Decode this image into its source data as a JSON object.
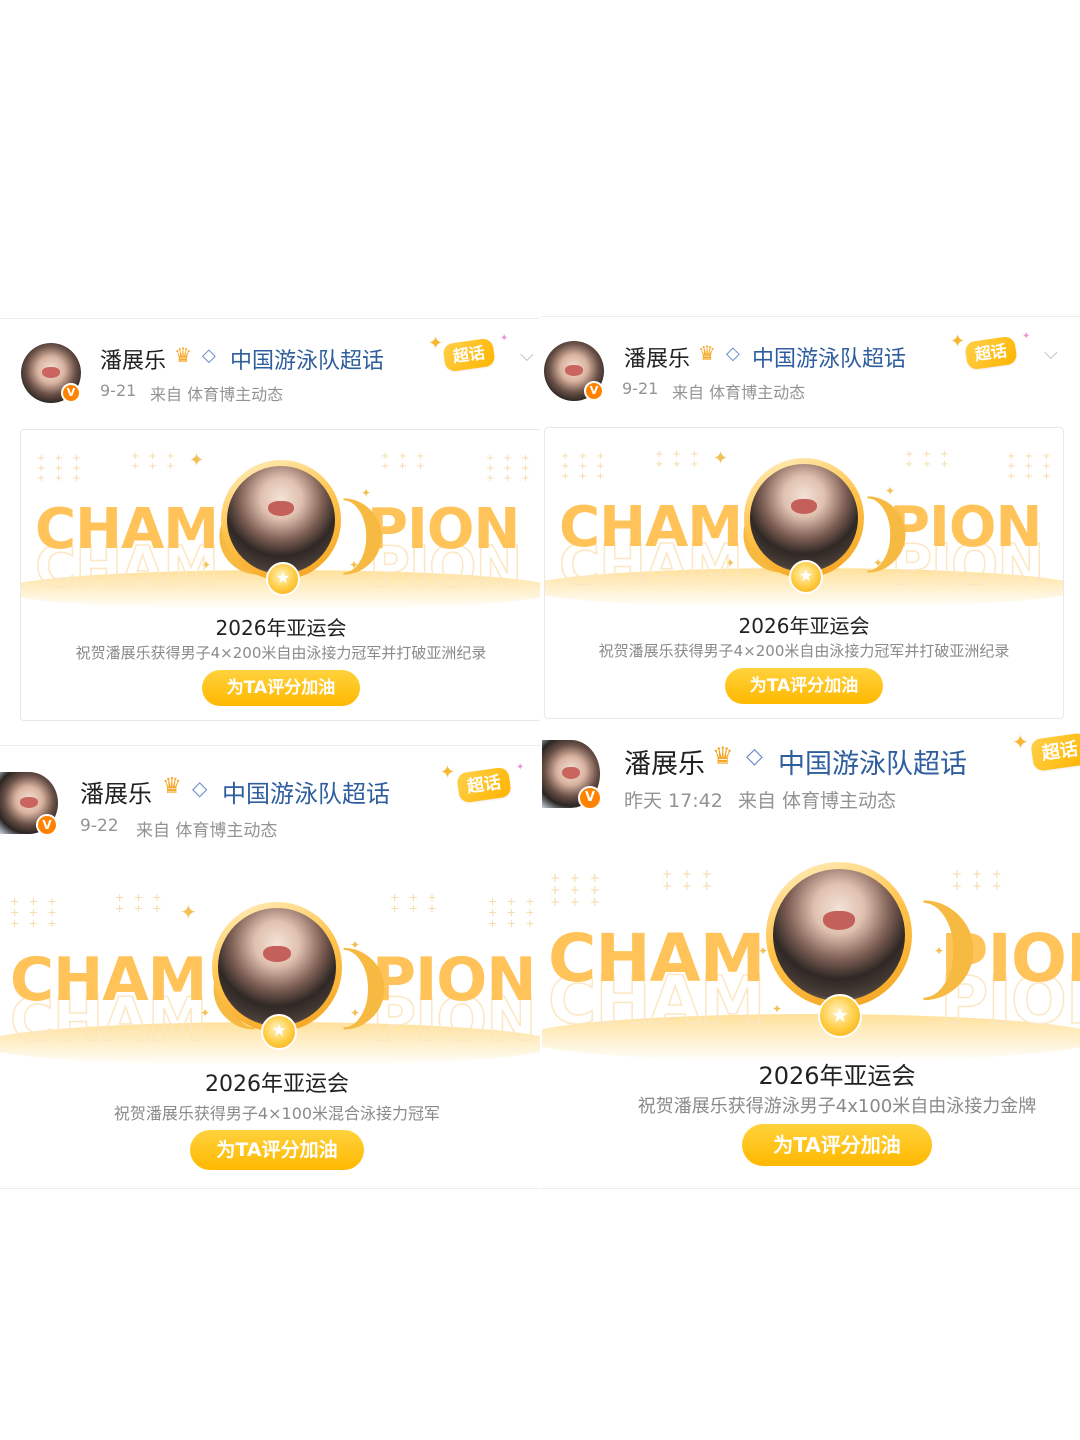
{
  "posts": [
    {
      "user": "潘展乐",
      "topic": "中国游泳队超话",
      "time": "9-21",
      "source": "来自 体育博主动态",
      "badge_label": "超话",
      "verified_mark": "V",
      "banner": {
        "left": "CHAM",
        "right": "PION"
      },
      "games": "2026年亚运会",
      "desc": "祝贺潘展乐获得男子4×200米自由泳接力冠军并打破亚洲纪录",
      "cta": "为TA评分加油"
    },
    {
      "user": "潘展乐",
      "topic": "中国游泳队超话",
      "time": "9-21",
      "source": "来自 体育博主动态",
      "badge_label": "超话",
      "verified_mark": "V",
      "banner": {
        "left": "CHAM",
        "right": "PION"
      },
      "games": "2026年亚运会",
      "desc": "祝贺潘展乐获得男子4×200米自由泳接力冠军并打破亚洲纪录",
      "cta": "为TA评分加油"
    },
    {
      "user": "潘展乐",
      "topic": "中国游泳队超话",
      "time": "9-22",
      "source": "来自 体育博主动态",
      "badge_label": "超话",
      "verified_mark": "V",
      "banner": {
        "left": "CHAM",
        "right": "PION"
      },
      "games": "2026年亚运会",
      "desc": "祝贺潘展乐获得男子4×100米混合泳接力冠军",
      "cta": "为TA评分加油"
    },
    {
      "user": "潘展乐",
      "topic": "中国游泳队超话",
      "time": "昨天 17:42",
      "source": "来自 体育博主动态",
      "badge_label": "超话",
      "verified_mark": "V",
      "banner": {
        "left": "CHAM",
        "right": "PION"
      },
      "games": "2026年亚运会",
      "desc": "祝贺潘展乐获得游泳男子4x100米自由泳接力金牌",
      "cta": "为TA评分加油"
    }
  ],
  "icons": {
    "crown": "crown-icon",
    "diamond": "diamond-icon",
    "chevron": "chevron-down-icon",
    "sparkle": "sparkle-icon",
    "laurel": "laurel-icon",
    "star_coin": "star-coin-icon"
  },
  "colors": {
    "topic": "#2f5e9e",
    "meta": "#939393",
    "cta": "#ffb800",
    "champion_text": "#ffc35a",
    "verified": "#ff8200"
  }
}
